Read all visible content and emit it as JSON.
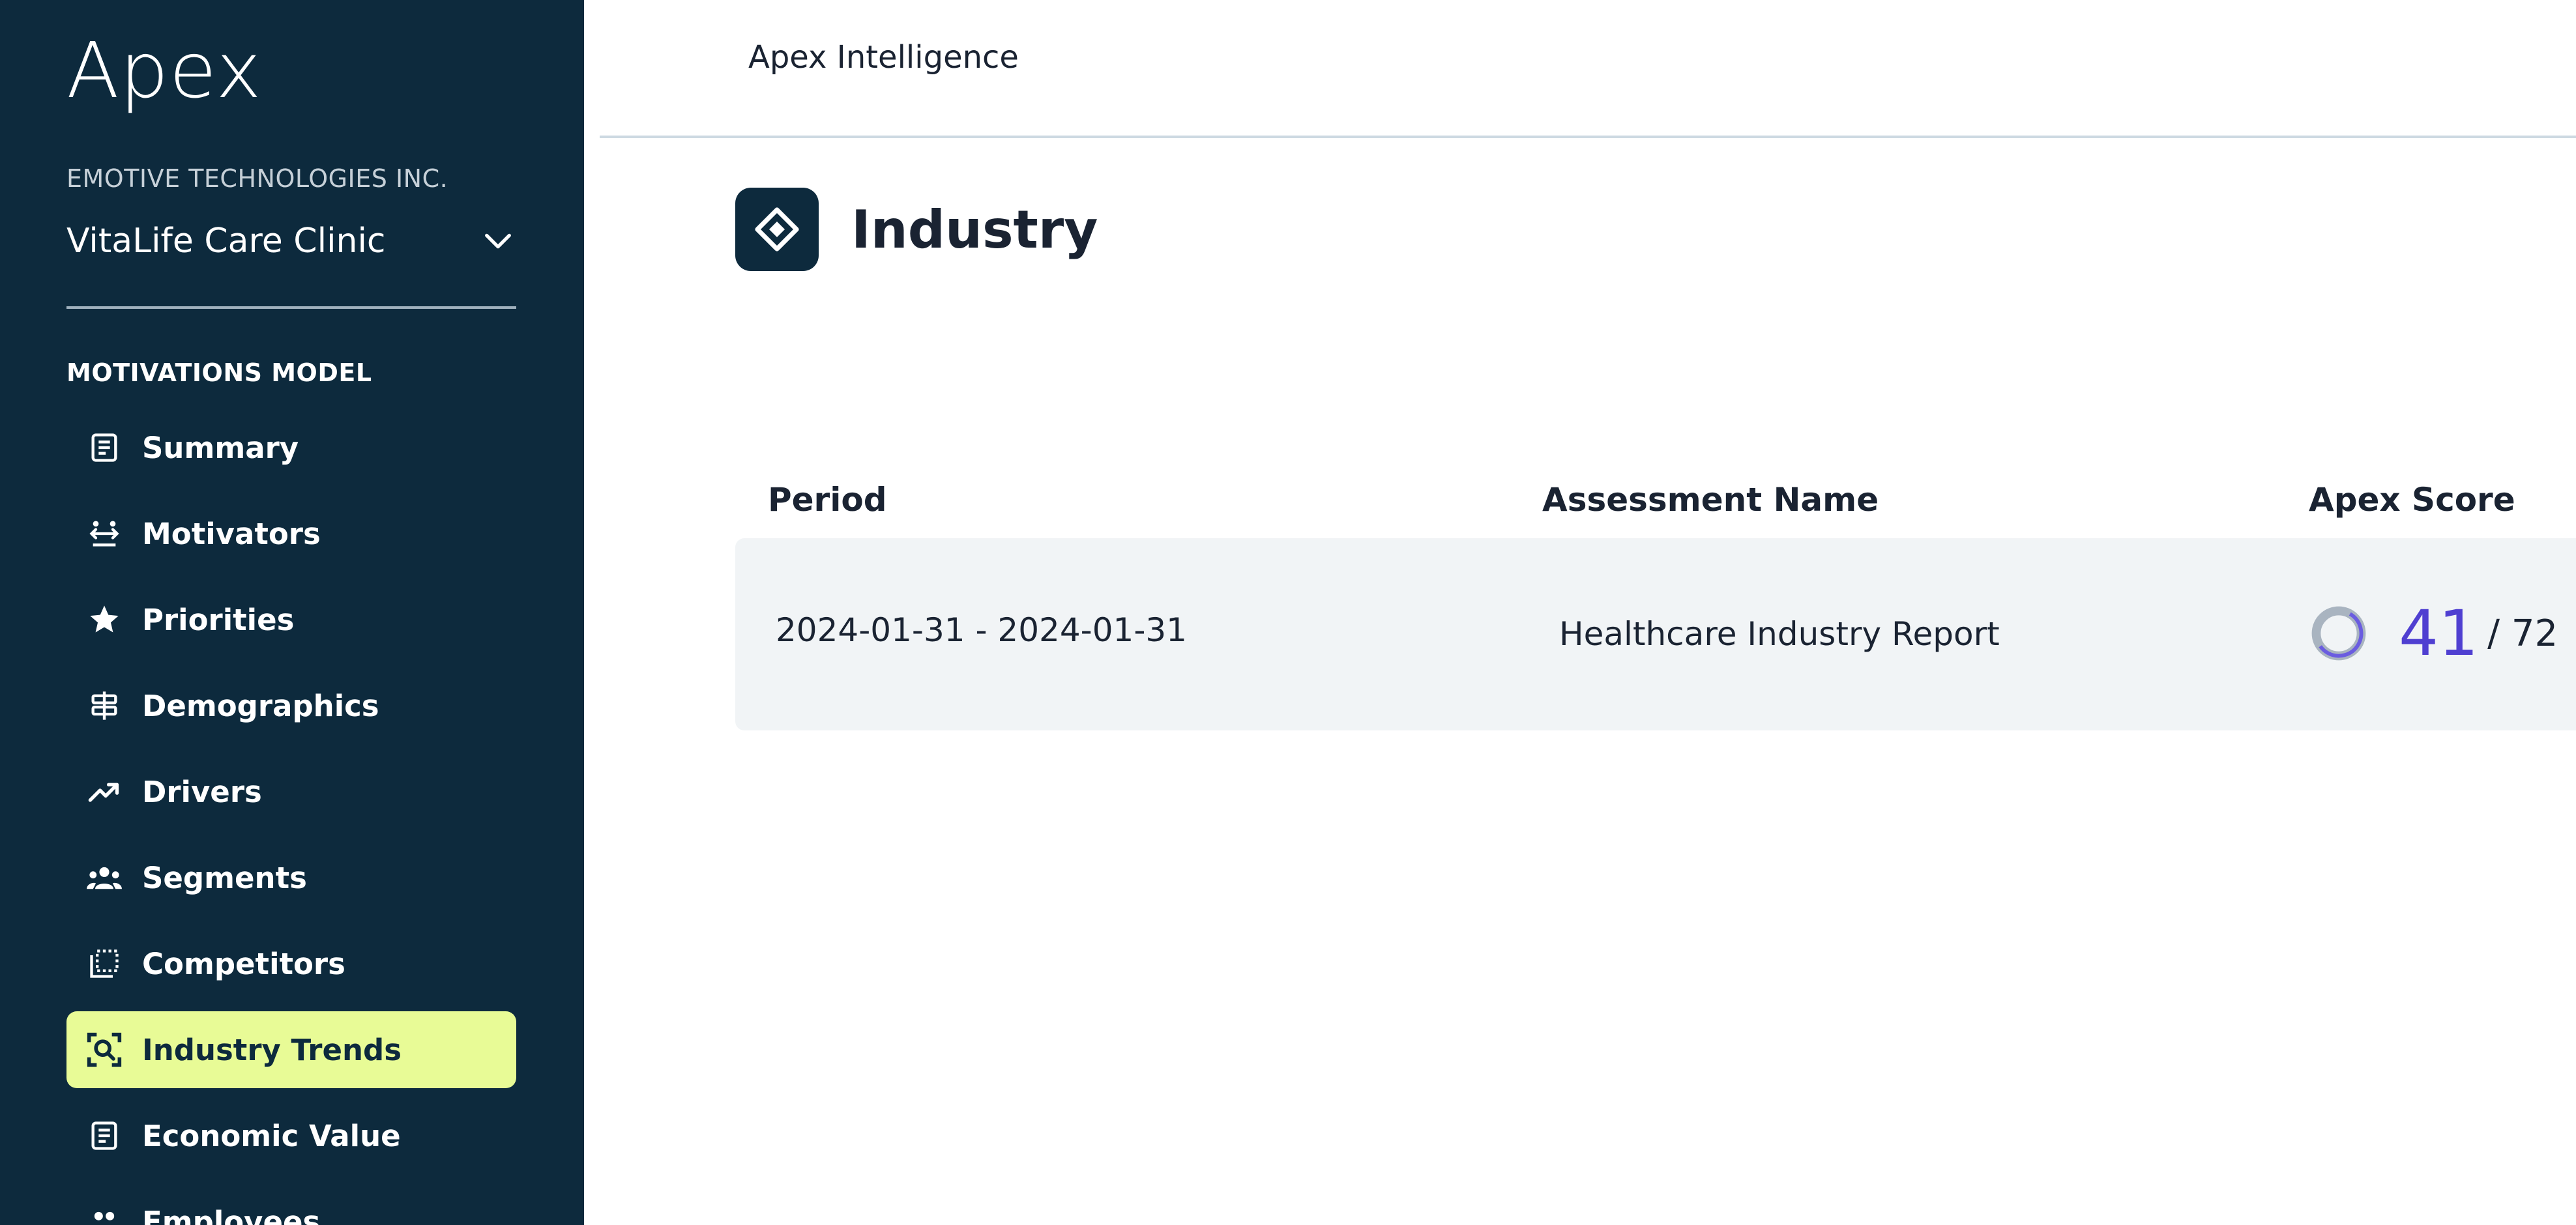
{
  "brand": {
    "logo_text": "Apex"
  },
  "org": {
    "company": "EMOTIVE TECHNOLOGIES INC.",
    "clinic": "VitaLife Care Clinic"
  },
  "sidebar": {
    "section_label": "MOTIVATIONS MODEL",
    "items": [
      {
        "label": "Summary",
        "icon": "document-icon",
        "active": false
      },
      {
        "label": "Motivators",
        "icon": "motivators-icon",
        "active": false
      },
      {
        "label": "Priorities",
        "icon": "star-icon",
        "active": false
      },
      {
        "label": "Demographics",
        "icon": "signpost-icon",
        "active": false
      },
      {
        "label": "Drivers",
        "icon": "trending-up-icon",
        "active": false
      },
      {
        "label": "Segments",
        "icon": "group-icon",
        "active": false
      },
      {
        "label": "Competitors",
        "icon": "compare-icon",
        "active": false
      },
      {
        "label": "Industry Trends",
        "icon": "search-scan-icon",
        "active": true
      },
      {
        "label": "Economic Value",
        "icon": "document-icon",
        "active": false
      },
      {
        "label": "Employees",
        "icon": "people-icon",
        "active": false
      }
    ]
  },
  "topbar": {
    "title": "Apex Intelligence"
  },
  "page": {
    "title": "Industry",
    "icon": "diamond-icon"
  },
  "table": {
    "columns": [
      "Period",
      "Assessment Name",
      "Apex Score"
    ],
    "rows": [
      {
        "period": "2024-01-31 - 2024-01-31",
        "assessment_name": "Healthcare Industry Report",
        "score": "41",
        "score_max": "/ 72",
        "score_fraction": 0.569
      }
    ]
  },
  "colors": {
    "sidebar_bg": "#0d2a3d",
    "active_item_bg": "#e8fb96",
    "score_accent": "#4f3fd1",
    "row_bg": "#f1f4f6"
  }
}
